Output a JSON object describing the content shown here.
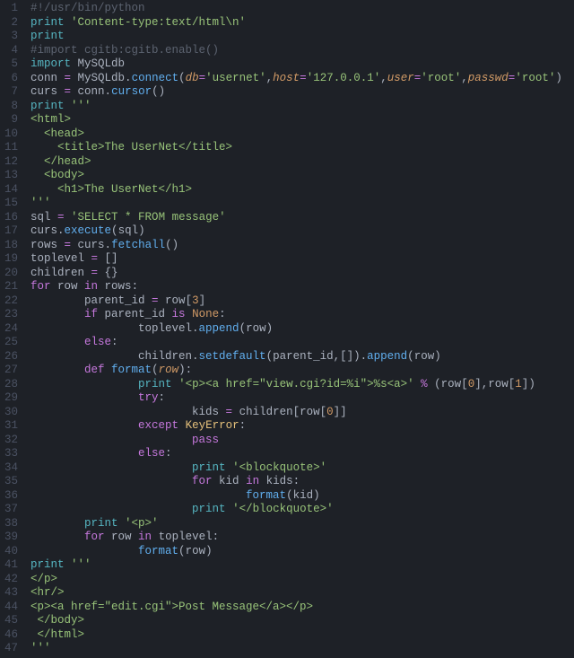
{
  "gutter": {
    "start": 1,
    "end": 47
  },
  "code": {
    "lines": [
      [
        [
          "cmt",
          "#!/usr/bin/python"
        ]
      ],
      [
        [
          "kw2",
          "print"
        ],
        [
          "plain",
          " "
        ],
        [
          "str",
          "'Content-type:text/html\\n'"
        ]
      ],
      [
        [
          "kw2",
          "print"
        ]
      ],
      [
        [
          "cmt",
          "#import cgitb:cgitb.enable()"
        ]
      ],
      [
        [
          "kw2",
          "import"
        ],
        [
          "plain",
          " "
        ],
        [
          "plain",
          "MySQLdb"
        ]
      ],
      [
        [
          "plain",
          "conn "
        ],
        [
          "op",
          "="
        ],
        [
          "plain",
          " MySQLdb"
        ],
        [
          "punc",
          "."
        ],
        [
          "fn",
          "connect"
        ],
        [
          "punc",
          "("
        ],
        [
          "param",
          "db"
        ],
        [
          "op",
          "="
        ],
        [
          "str",
          "'usernet'"
        ],
        [
          "punc",
          ","
        ],
        [
          "param",
          "host"
        ],
        [
          "op",
          "="
        ],
        [
          "str",
          "'127.0.0.1'"
        ],
        [
          "punc",
          ","
        ],
        [
          "param",
          "user"
        ],
        [
          "op",
          "="
        ],
        [
          "str",
          "'root'"
        ],
        [
          "punc",
          ","
        ],
        [
          "param",
          "passwd"
        ],
        [
          "op",
          "="
        ],
        [
          "str",
          "'root'"
        ],
        [
          "punc",
          ")"
        ]
      ],
      [
        [
          "plain",
          "curs "
        ],
        [
          "op",
          "="
        ],
        [
          "plain",
          " conn"
        ],
        [
          "punc",
          "."
        ],
        [
          "fn",
          "cursor"
        ],
        [
          "punc",
          "()"
        ]
      ],
      [
        [
          "kw2",
          "print"
        ],
        [
          "plain",
          " "
        ],
        [
          "str",
          "'''"
        ]
      ],
      [
        [
          "str",
          "<html>"
        ]
      ],
      [
        [
          "str",
          "  <head>"
        ]
      ],
      [
        [
          "str",
          "    <title>The UserNet</title>"
        ]
      ],
      [
        [
          "str",
          "  </head>"
        ]
      ],
      [
        [
          "str",
          "  <body>"
        ]
      ],
      [
        [
          "str",
          "    <h1>The UserNet</h1>"
        ]
      ],
      [
        [
          "str",
          "'''"
        ]
      ],
      [
        [
          "plain",
          "sql "
        ],
        [
          "op",
          "="
        ],
        [
          "plain",
          " "
        ],
        [
          "str",
          "'SELECT * FROM message'"
        ]
      ],
      [
        [
          "plain",
          "curs"
        ],
        [
          "punc",
          "."
        ],
        [
          "fn",
          "execute"
        ],
        [
          "punc",
          "("
        ],
        [
          "plain",
          "sql"
        ],
        [
          "punc",
          ")"
        ]
      ],
      [
        [
          "plain",
          "rows "
        ],
        [
          "op",
          "="
        ],
        [
          "plain",
          " curs"
        ],
        [
          "punc",
          "."
        ],
        [
          "fn",
          "fetchall"
        ],
        [
          "punc",
          "()"
        ]
      ],
      [
        [
          "plain",
          "toplevel "
        ],
        [
          "op",
          "="
        ],
        [
          "plain",
          " "
        ],
        [
          "punc",
          "[]"
        ]
      ],
      [
        [
          "plain",
          "children "
        ],
        [
          "op",
          "="
        ],
        [
          "plain",
          " "
        ],
        [
          "punc",
          "{}"
        ]
      ],
      [
        [
          "kw",
          "for"
        ],
        [
          "plain",
          " row "
        ],
        [
          "kw",
          "in"
        ],
        [
          "plain",
          " rows"
        ],
        [
          "punc",
          ":"
        ]
      ],
      [
        [
          "plain",
          "        parent_id "
        ],
        [
          "op",
          "="
        ],
        [
          "plain",
          " row"
        ],
        [
          "punc",
          "["
        ],
        [
          "num",
          "3"
        ],
        [
          "punc",
          "]"
        ]
      ],
      [
        [
          "plain",
          "        "
        ],
        [
          "kw",
          "if"
        ],
        [
          "plain",
          " parent_id "
        ],
        [
          "kw",
          "is"
        ],
        [
          "plain",
          " "
        ],
        [
          "const",
          "None"
        ],
        [
          "punc",
          ":"
        ]
      ],
      [
        [
          "plain",
          "                toplevel"
        ],
        [
          "punc",
          "."
        ],
        [
          "fn",
          "append"
        ],
        [
          "punc",
          "("
        ],
        [
          "plain",
          "row"
        ],
        [
          "punc",
          ")"
        ]
      ],
      [
        [
          "plain",
          "        "
        ],
        [
          "kw",
          "else"
        ],
        [
          "punc",
          ":"
        ]
      ],
      [
        [
          "plain",
          "                children"
        ],
        [
          "punc",
          "."
        ],
        [
          "fn",
          "setdefault"
        ],
        [
          "punc",
          "("
        ],
        [
          "plain",
          "parent_id"
        ],
        [
          "punc",
          ","
        ],
        [
          "punc",
          "[]"
        ],
        [
          "punc",
          ")"
        ],
        [
          "punc",
          "."
        ],
        [
          "fn",
          "append"
        ],
        [
          "punc",
          "("
        ],
        [
          "plain",
          "row"
        ],
        [
          "punc",
          ")"
        ]
      ],
      [
        [
          "plain",
          "        "
        ],
        [
          "kw",
          "def"
        ],
        [
          "plain",
          " "
        ],
        [
          "fn",
          "format"
        ],
        [
          "punc",
          "("
        ],
        [
          "param",
          "row"
        ],
        [
          "punc",
          ")"
        ],
        [
          "punc",
          ":"
        ]
      ],
      [
        [
          "plain",
          "                "
        ],
        [
          "kw2",
          "print"
        ],
        [
          "plain",
          " "
        ],
        [
          "str",
          "'<p><a href=\"view.cgi?id=%i\">%s<a>'"
        ],
        [
          "plain",
          " "
        ],
        [
          "op",
          "%"
        ],
        [
          "plain",
          " "
        ],
        [
          "punc",
          "("
        ],
        [
          "plain",
          "row"
        ],
        [
          "punc",
          "["
        ],
        [
          "num",
          "0"
        ],
        [
          "punc",
          "]"
        ],
        [
          "punc",
          ","
        ],
        [
          "plain",
          "row"
        ],
        [
          "punc",
          "["
        ],
        [
          "num",
          "1"
        ],
        [
          "punc",
          "]"
        ],
        [
          "punc",
          ")"
        ]
      ],
      [
        [
          "plain",
          "                "
        ],
        [
          "kw",
          "try"
        ],
        [
          "punc",
          ":"
        ]
      ],
      [
        [
          "plain",
          "                        kids "
        ],
        [
          "op",
          "="
        ],
        [
          "plain",
          " children"
        ],
        [
          "punc",
          "["
        ],
        [
          "plain",
          "row"
        ],
        [
          "punc",
          "["
        ],
        [
          "num",
          "0"
        ],
        [
          "punc",
          "]"
        ],
        [
          "punc",
          "]"
        ]
      ],
      [
        [
          "plain",
          "                "
        ],
        [
          "kw",
          "except"
        ],
        [
          "plain",
          " "
        ],
        [
          "exc",
          "KeyError"
        ],
        [
          "punc",
          ":"
        ]
      ],
      [
        [
          "plain",
          "                        "
        ],
        [
          "kw",
          "pass"
        ]
      ],
      [
        [
          "plain",
          "                "
        ],
        [
          "kw",
          "else"
        ],
        [
          "punc",
          ":"
        ]
      ],
      [
        [
          "plain",
          "                        "
        ],
        [
          "kw2",
          "print"
        ],
        [
          "plain",
          " "
        ],
        [
          "str",
          "'<blockquote>'"
        ]
      ],
      [
        [
          "plain",
          "                        "
        ],
        [
          "kw",
          "for"
        ],
        [
          "plain",
          " kid "
        ],
        [
          "kw",
          "in"
        ],
        [
          "plain",
          " kids"
        ],
        [
          "punc",
          ":"
        ]
      ],
      [
        [
          "plain",
          "                                "
        ],
        [
          "fn",
          "format"
        ],
        [
          "punc",
          "("
        ],
        [
          "plain",
          "kid"
        ],
        [
          "punc",
          ")"
        ]
      ],
      [
        [
          "plain",
          "                        "
        ],
        [
          "kw2",
          "print"
        ],
        [
          "plain",
          " "
        ],
        [
          "str",
          "'</blockquote>'"
        ]
      ],
      [
        [
          "plain",
          "        "
        ],
        [
          "kw2",
          "print"
        ],
        [
          "plain",
          " "
        ],
        [
          "str",
          "'<p>'"
        ]
      ],
      [
        [
          "plain",
          "        "
        ],
        [
          "kw",
          "for"
        ],
        [
          "plain",
          " row "
        ],
        [
          "kw",
          "in"
        ],
        [
          "plain",
          " toplevel"
        ],
        [
          "punc",
          ":"
        ]
      ],
      [
        [
          "plain",
          "                "
        ],
        [
          "fn",
          "format"
        ],
        [
          "punc",
          "("
        ],
        [
          "plain",
          "row"
        ],
        [
          "punc",
          ")"
        ]
      ],
      [
        [
          "kw2",
          "print"
        ],
        [
          "plain",
          " "
        ],
        [
          "str",
          "'''"
        ]
      ],
      [
        [
          "str",
          "</p>"
        ]
      ],
      [
        [
          "str",
          "<hr/>"
        ]
      ],
      [
        [
          "str",
          "<p><a href=\"edit.cgi\">Post Message</a></p>"
        ]
      ],
      [
        [
          "str",
          " </body>"
        ]
      ],
      [
        [
          "str",
          " </html>"
        ]
      ],
      [
        [
          "str",
          "'''"
        ]
      ]
    ]
  }
}
